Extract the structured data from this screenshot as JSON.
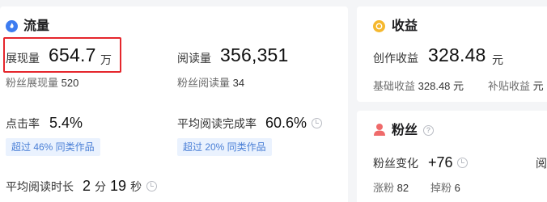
{
  "traffic": {
    "title": "流量",
    "views_label": "展现量",
    "views_value": "654.7",
    "views_unit": "万",
    "reads_label": "阅读量",
    "reads_value": "356,351",
    "fan_views_label": "粉丝展现量",
    "fan_views_value": "520",
    "fan_reads_label": "粉丝阅读量",
    "fan_reads_value": "34",
    "ctr_label": "点击率",
    "ctr_value": "5.4%",
    "ctr_tag": "超过 46% 同类作品",
    "completion_label": "平均阅读完成率",
    "completion_value": "60.6%",
    "completion_tag": "超过 20% 同类作品",
    "avg_time_label": "平均阅读时长",
    "avg_time_min": "2",
    "avg_time_min_unit": "分",
    "avg_time_sec": "19",
    "avg_time_sec_unit": "秒"
  },
  "income": {
    "title": "收益",
    "creation_label": "创作收益",
    "creation_value": "328.48",
    "creation_unit": "元",
    "base_label": "基础收益",
    "base_value": "328.48 元",
    "subsidy_label": "补贴收益",
    "subsidy_value": "元"
  },
  "fans": {
    "title": "粉丝",
    "change_label": "粉丝变化",
    "change_value": "+76",
    "gain_label": "涨粉",
    "gain_value": "82",
    "loss_label": "掉粉",
    "loss_value": "6",
    "right_cut_label": "阅"
  },
  "colors": {
    "highlight": "#e5262c",
    "tag_text": "#4a7fd6",
    "tag_bg": "#eaf2fe",
    "traffic_icon": "#3d7cf0",
    "income_icon": "#f5b82e",
    "fans_icon": "#ef6a6a"
  }
}
